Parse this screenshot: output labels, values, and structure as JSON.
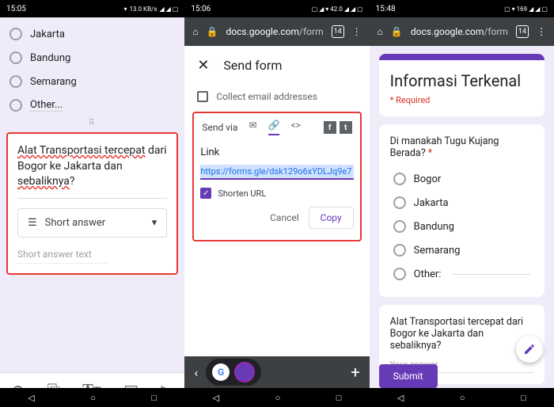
{
  "status": {
    "t1": "15:05",
    "t2": "15:06",
    "t3": "15:48",
    "net": "13.0 KB/s"
  },
  "url": {
    "domain": "docs.google.com",
    "path": "/forms",
    "tabs": "14"
  },
  "panel1": {
    "options": [
      "Jakarta",
      "Bandung",
      "Semarang",
      "Other..."
    ],
    "question_p1": "Alat Transportasi tercepat",
    "question_p2": " dari Bogor ke Jakarta dan ",
    "question_p3": "sebaliknya",
    "question_p4": "?",
    "qtype": "Short answer",
    "placeholder": "Short answer text"
  },
  "panel2": {
    "title": "Send form",
    "collect": "Collect email addresses",
    "sendvia": "Send via",
    "link_label": "Link",
    "link_value": "https://forms.gle/dsk129o6xYDLJq9e7",
    "shorten": "Shorten URL",
    "cancel": "Cancel",
    "copy": "Copy"
  },
  "panel3": {
    "title": "Informasi Terkenal",
    "required": "* Required",
    "q1": "Di manakah Tugu Kujang Berada? ",
    "q1_options": [
      "Bogor",
      "Jakarta",
      "Bandung",
      "Semarang",
      "Other:"
    ],
    "q2": "Alat Transportasi tercepat dari Bogor ke Jakarta dan sebaliknya?",
    "answer_ph": "Your answer",
    "submit": "Submit"
  }
}
